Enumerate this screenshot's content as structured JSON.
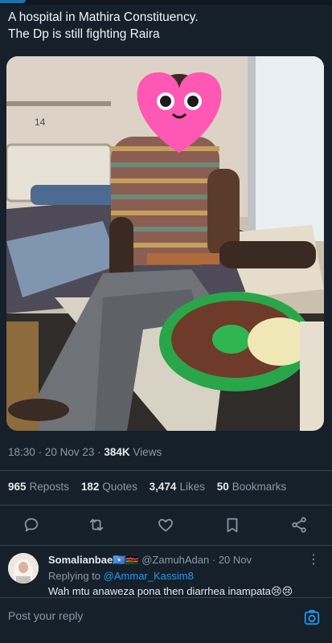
{
  "tweet": {
    "text": "A hospital in Mathira Constituency.\nThe Dp is still fighting Raira"
  },
  "photo": {
    "bed_number": "14"
  },
  "meta": {
    "time": "18:30",
    "date": "20 Nov 23",
    "views_count": "384K",
    "views_label": "Views"
  },
  "stats": {
    "reposts_count": "965",
    "reposts_label": "Reposts",
    "quotes_count": "182",
    "quotes_label": "Quotes",
    "likes_count": "3,474",
    "likes_label": "Likes",
    "bookmarks_count": "50",
    "bookmarks_label": "Bookmarks"
  },
  "actions": [
    "reply-icon",
    "repost-icon",
    "like-icon",
    "bookmark-icon",
    "share-icon"
  ],
  "reply": {
    "name": "Somalianbae🇸🇴🇰🇪",
    "handle": "@ZamuhAdan",
    "sep": "·",
    "date": "20 Nov",
    "replying_label": "Replying to",
    "replying_handle": "@Ammar_Kassim8",
    "text": "Wah mtu anaweza pona then diarrhea inampata😢😢",
    "more": "⋮"
  },
  "compose": {
    "placeholder": "Post your reply"
  },
  "colors": {
    "background": "#15202b",
    "accent": "#1d9bf0",
    "muted": "#8b98a5"
  }
}
